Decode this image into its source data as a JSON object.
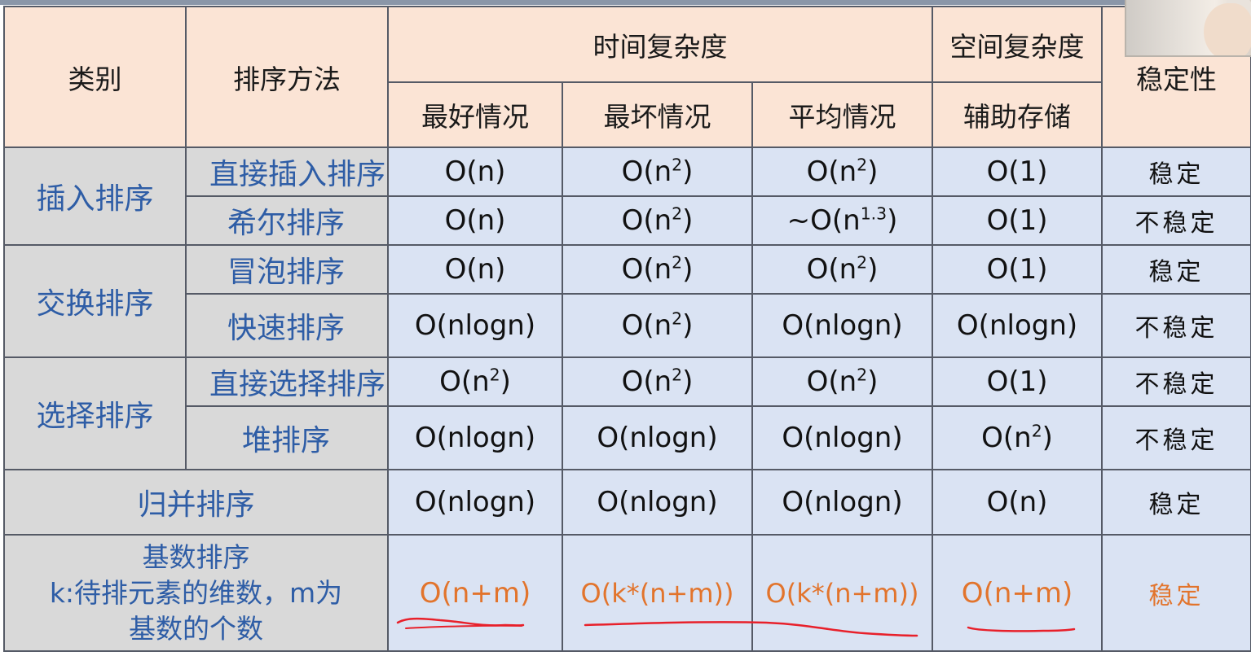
{
  "headers": {
    "category": "类别",
    "method": "排序方法",
    "time_complexity": "时间复杂度",
    "space_complexity": "空间复杂度",
    "stability": "稳定性",
    "best": "最好情况",
    "worst": "最坏情况",
    "average": "平均情况",
    "auxiliary": "辅助存储"
  },
  "categories": {
    "insertion": "插入排序",
    "exchange": "交换排序",
    "selection": "选择排序",
    "merge": "归并排序",
    "radix_line1": "基数排序",
    "radix_line2": "k:待排元素的维数，m为",
    "radix_line3": "基数的个数"
  },
  "rows": [
    {
      "method": "直接插入排序",
      "best": "O(n)",
      "worst_base": "O(n",
      "worst_exp": "2",
      "average_base": "O(n",
      "average_exp": "2",
      "aux": "O(1)",
      "stability": "稳定"
    },
    {
      "method": "希尔排序",
      "best": "O(n)",
      "worst_base": "O(n",
      "worst_exp": "2",
      "average_base": "~O(n",
      "average_exp": "1.3",
      "aux": "O(1)",
      "stability": "不稳定"
    },
    {
      "method": "冒泡排序",
      "best": "O(n)",
      "worst_base": "O(n",
      "worst_exp": "2",
      "average_base": "O(n",
      "average_exp": "2",
      "aux": "O(1)",
      "stability": "稳定"
    },
    {
      "method": "快速排序",
      "best": "O(nlogn)",
      "worst_base": "O(n",
      "worst_exp": "2",
      "average": "O(nlogn)",
      "aux": "O(nlogn)",
      "stability": "不稳定"
    },
    {
      "method": "直接选择排序",
      "best_base": "O(n",
      "best_exp": "2",
      "worst_base": "O(n",
      "worst_exp": "2",
      "average_base": "O(n",
      "average_exp": "2",
      "aux": "O(1)",
      "stability": "不稳定"
    },
    {
      "method": "堆排序",
      "best": "O(nlogn)",
      "worst": "O(nlogn)",
      "average": "O(nlogn)",
      "aux_base": "O(n",
      "aux_exp": "2",
      "stability": "不稳定"
    },
    {
      "best": "O(nlogn)",
      "worst": "O(nlogn)",
      "average": "O(nlogn)",
      "aux": "O(n)",
      "stability": "稳定"
    },
    {
      "best": "O(n+m)",
      "worst": "O(k*(n+m))",
      "average": "O(k*(n+m))",
      "aux": "O(n+m)",
      "stability": "稳定"
    }
  ],
  "colors": {
    "header_bg": "#fbe4d5",
    "label_bg": "#d9d9d9",
    "value_bg": "#dae3f3",
    "label_text": "#2e5da6",
    "highlight_text": "#e2742c",
    "annotation_ink": "#e8202a"
  }
}
